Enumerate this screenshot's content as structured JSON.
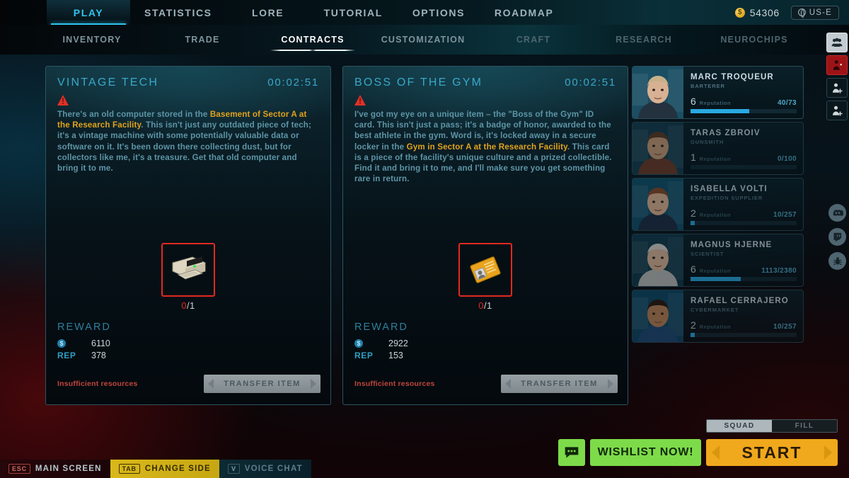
{
  "topnav": {
    "items": [
      {
        "label": "PLAY",
        "active": true
      },
      {
        "label": "STATISTICS",
        "active": false
      },
      {
        "label": "LORE",
        "active": false
      },
      {
        "label": "TUTORIAL",
        "active": false
      },
      {
        "label": "OPTIONS",
        "active": false
      },
      {
        "label": "ROADMAP",
        "active": false
      }
    ],
    "currency": "54306",
    "currency_icon": "coin-icon",
    "region": "US-E",
    "region_icon": "globe-icon"
  },
  "subnav": {
    "items": [
      {
        "label": "INVENTORY",
        "state": "normal"
      },
      {
        "label": "TRADE",
        "state": "normal"
      },
      {
        "label": "CONTRACTS",
        "state": "active"
      },
      {
        "label": "CUSTOMIZATION",
        "state": "normal"
      },
      {
        "label": "CRAFT",
        "state": "dim"
      },
      {
        "label": "RESEARCH",
        "state": "dim"
      },
      {
        "label": "NEUROCHIPS",
        "state": "dim"
      }
    ]
  },
  "rail": {
    "buttons": [
      {
        "icon": "squad-people-icon",
        "style": "light"
      },
      {
        "icon": "crossed-out-player-icon",
        "style": "red"
      },
      {
        "icon": "add-player-icon",
        "style": "dark"
      },
      {
        "icon": "invite-player-icon",
        "style": "dark"
      }
    ],
    "social": [
      {
        "icon": "discord-icon"
      },
      {
        "icon": "twitch-icon"
      },
      {
        "icon": "bug-report-icon"
      }
    ]
  },
  "contracts": [
    {
      "title": "VINTAGE TECH",
      "timer": "00:02:51",
      "warning_icon": "warning-triangle-icon",
      "desc_parts": [
        {
          "t": "There's an old computer stored in the ",
          "hl": false
        },
        {
          "t": "Basement of Sector A at the Research Facility",
          "hl": true
        },
        {
          "t": ". This isn't just any outdated piece of tech; it's a vintage machine with some potentially valuable data or software on it. It's been down there collecting dust, but for collectors like me, it's a treasure. Get that old computer and bring it to me.",
          "hl": false
        }
      ],
      "item_icon": "vintage-computer-icon",
      "item_have": "0",
      "item_need": "/1",
      "reward_label": "REWARD",
      "reward_money_icon": "money-icon",
      "reward_money": "6110",
      "reward_rep_label": "REP",
      "reward_rep": "378",
      "status": "Insufficient resources",
      "transfer_label": "TRANSFER ITEM"
    },
    {
      "title": "BOSS OF THE GYM",
      "timer": "00:02:51",
      "warning_icon": "warning-triangle-icon",
      "desc_parts": [
        {
          "t": "I've got my eye on a unique item – the \"Boss of the Gym\" ID card. This isn't just a pass; it's a badge of honor, awarded to the best athlete in the gym. Word is, it's locked away in a secure locker in the ",
          "hl": false
        },
        {
          "t": "Gym in Sector A at the Research Facility",
          "hl": true
        },
        {
          "t": ". This card is a piece of the facility's unique culture and a prized collectible. Find it and bring it to me, and I'll make sure you get something rare in return.",
          "hl": false
        }
      ],
      "item_icon": "id-card-icon",
      "item_have": "0",
      "item_need": "/1",
      "reward_label": "REWARD",
      "reward_money_icon": "money-icon",
      "reward_money": "2922",
      "reward_rep_label": "REP",
      "reward_rep": "153",
      "status": "Insufficient resources",
      "transfer_label": "TRANSFER ITEM"
    }
  ],
  "characters": [
    {
      "name": "MARC TROQUEUR",
      "role": "BARTERER",
      "level": "6",
      "rep_label": "Reputation",
      "rep_amount": "40/73",
      "rep_pct": 55,
      "selected": true,
      "hair": "#c8b089",
      "skin": "#d8b194",
      "coat": "#24313f",
      "bg": "#1a4e63"
    },
    {
      "name": "TARAS ZBROIV",
      "role": "GUNSMITH",
      "level": "1",
      "rep_label": "Reputation",
      "rep_amount": "0/100",
      "rep_pct": 0,
      "selected": false,
      "hair": "#5d3a20",
      "skin": "#c89a76",
      "coat": "#6b3a26",
      "bg": "#143b4d"
    },
    {
      "name": "ISABELLA VOLTI",
      "role": "EXPEDITION SUPPLIER",
      "level": "2",
      "rep_label": "Reputation",
      "rep_amount": "10/257",
      "rep_pct": 4,
      "selected": false,
      "hair": "#8a4a28",
      "skin": "#e0b391",
      "coat": "#1d2c45",
      "bg": "#11506a"
    },
    {
      "name": "MAGNUS HJERNE",
      "role": "SCIENTIST",
      "level": "6",
      "rep_label": "Reputation",
      "rep_amount": "1113/2380",
      "rep_pct": 47,
      "selected": false,
      "hair": "#d9d6cf",
      "skin": "#dcb79a",
      "coat": "#b9bdba",
      "bg": "#0f3a4c"
    },
    {
      "name": "RAFAEL CERRAJERO",
      "role": "CYBERMARKET",
      "level": "2",
      "rep_label": "Reputation",
      "rep_amount": "10/257",
      "rep_pct": 4,
      "selected": false,
      "hair": "#2b1a12",
      "skin": "#b98458",
      "coat": "#1b4d7a",
      "bg": "#0d4a68"
    }
  ],
  "bottom": {
    "squad_label": "SQUAD",
    "fill_label": "FILL",
    "squad_active": true,
    "chat_icon": "chat-bubble-icon",
    "wishlist_label": "WISHLIST NOW!",
    "start_label": "START"
  },
  "hotkeys": [
    {
      "key": "ESC",
      "label": "MAIN SCREEN",
      "style": "esc"
    },
    {
      "key": "TAB",
      "label": "CHANGE SIDE",
      "style": "tab"
    },
    {
      "key": "V",
      "label": "VOICE CHAT",
      "style": "v"
    }
  ]
}
